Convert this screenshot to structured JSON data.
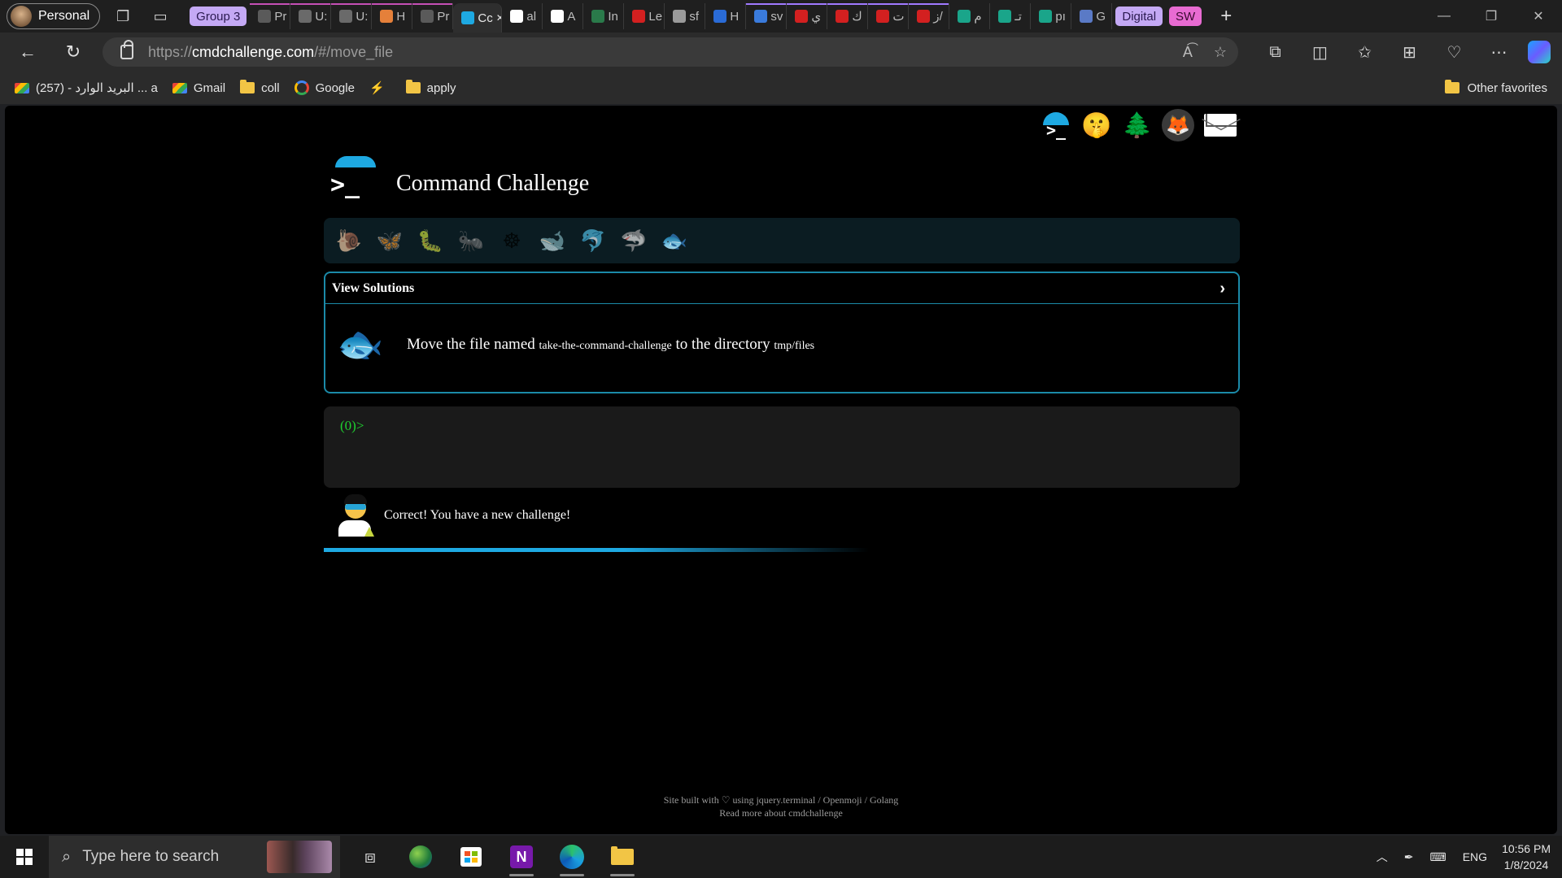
{
  "browser": {
    "profile_label": "Personal",
    "tab_groups": [
      {
        "label": "Group 3",
        "bg": "#c4a9f5",
        "fg": "#2a1a50"
      },
      {
        "label": "Digital",
        "bg": "#c4a9f5",
        "fg": "#2a1a50"
      },
      {
        "label": "SW",
        "bg": "#e86bd2",
        "fg": "#3a0a30"
      }
    ],
    "tabs": [
      {
        "label": "Pr",
        "favicon_color": "#5a5a5a"
      },
      {
        "label": "U:",
        "favicon_color": "#6a6a6a"
      },
      {
        "label": "U:",
        "favicon_color": "#6a6a6a"
      },
      {
        "label": "H",
        "favicon_color": "#e5803a"
      },
      {
        "label": "Pr",
        "favicon_color": "#5a5a5a"
      },
      {
        "label": "Cc",
        "favicon_color": "#1ea9e2",
        "active": true
      },
      {
        "label": "al",
        "favicon_color": "#ffffff"
      },
      {
        "label": "A",
        "favicon_color": "#ffffff"
      },
      {
        "label": "In",
        "favicon_color": "#2a7a4a"
      },
      {
        "label": "Le",
        "favicon_color": "#d32020"
      },
      {
        "label": "sf",
        "favicon_color": "#9a9a9a"
      },
      {
        "label": "H",
        "favicon_color": "#2a6bd6"
      },
      {
        "label": "sv",
        "favicon_color": "#3a7bdc"
      },
      {
        "label": "ي",
        "favicon_color": "#d32020"
      },
      {
        "label": "ك",
        "favicon_color": "#d32020"
      },
      {
        "label": "ت",
        "favicon_color": "#d32020"
      },
      {
        "label": "ز/",
        "favicon_color": "#d32020"
      },
      {
        "label": "م",
        "favicon_color": "#1aa58a"
      },
      {
        "label": "تـ",
        "favicon_color": "#1aa58a"
      },
      {
        "label": "pı",
        "favicon_color": "#1aa58a"
      },
      {
        "label": "G",
        "favicon_color": "#5a7ac6"
      }
    ],
    "url_prefix": "https://",
    "url_host": "cmdchallenge.com",
    "url_path": "/#/move_file",
    "bookmarks": [
      {
        "label": "(257) - البريد الوارد ... a",
        "icon": "gmail-icon"
      },
      {
        "label": "Gmail",
        "icon": "gmail-icon"
      },
      {
        "label": "coll",
        "icon": "folder-icon"
      },
      {
        "label": "Google",
        "icon": "google-icon"
      },
      {
        "label": "",
        "icon": "bookmark-app-icon"
      },
      {
        "label": "apply",
        "icon": "folder-icon"
      }
    ],
    "other_favorites": "Other favorites"
  },
  "site": {
    "title": "Command Challenge",
    "top_icons": [
      "terminal-icon",
      "shushing-face-icon",
      "tree-icon",
      "gitlab-icon",
      "mail-icon"
    ],
    "levels": [
      {
        "name": "snail-icon",
        "glyph": "🐌"
      },
      {
        "name": "butterfly-icon",
        "glyph": "🦋"
      },
      {
        "name": "caterpillar-icon",
        "glyph": "🐛"
      },
      {
        "name": "ant-icon",
        "glyph": "🐜"
      },
      {
        "name": "wheel-icon",
        "glyph": "☸"
      },
      {
        "name": "whale-icon",
        "glyph": "🐋"
      },
      {
        "name": "dolphin-icon",
        "glyph": "🐬"
      },
      {
        "name": "shark-icon",
        "glyph": "🦈"
      },
      {
        "name": "fish-icon",
        "glyph": "🐟"
      }
    ],
    "panel": {
      "header": "View Solutions",
      "task_part1": "Move the file named ",
      "task_file": "take-the-command-challenge",
      "task_part2": " to the directory ",
      "task_dir": "tmp/files"
    },
    "terminal_prompt": "(0)>",
    "result_message": "Correct! You have a new challenge!",
    "footer_line1": "Site built with ♡ using jquery.terminal / Openmoji / Golang",
    "footer_line2": "Read more about cmdchallenge"
  },
  "taskbar": {
    "search_placeholder": "Type here to search",
    "language": "ENG",
    "time": "10:56 PM",
    "date": "1/8/2024"
  }
}
